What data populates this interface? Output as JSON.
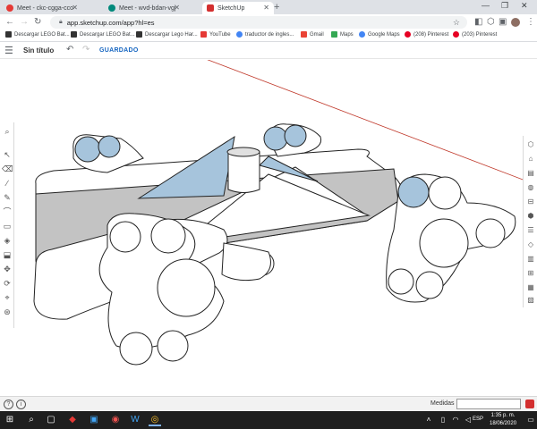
{
  "browser": {
    "tabs": [
      {
        "title": "Meet - ckc-cgga-cco",
        "favicon": "meet-record-icon"
      },
      {
        "title": "Meet - wvd-bdan-vgj",
        "favicon": "meet-icon"
      },
      {
        "title": "SketchUp",
        "favicon": "sketchup-icon",
        "active": true
      }
    ],
    "new_tab_symbol": "+",
    "url": "app.sketchup.com/app?hl=es",
    "bookmarks": [
      {
        "label": "Descargar LEGO Bat...",
        "icon": "lego-icon"
      },
      {
        "label": "Descargar LEGO Bat...",
        "icon": "lego-icon"
      },
      {
        "label": "Descargar Lego Har...",
        "icon": "lego-icon"
      },
      {
        "label": "YouTube",
        "icon": "youtube-icon"
      },
      {
        "label": "traductor de ingles...",
        "icon": "google-icon"
      },
      {
        "label": "Gmail",
        "icon": "gmail-icon"
      },
      {
        "label": "Maps",
        "icon": "maps-icon"
      },
      {
        "label": "Google Maps",
        "icon": "google-icon"
      },
      {
        "label": "(208) Pinterest",
        "icon": "pinterest-icon"
      },
      {
        "label": "(203) Pinterest",
        "icon": "pinterest-icon"
      }
    ]
  },
  "sketchup": {
    "document_title": "Sin título",
    "save_status": "GUARDADO",
    "measurements_label": "Medidas",
    "measurements_value": ""
  },
  "taskbar": {
    "language": "ESP",
    "time": "1:35 p. m.",
    "date": "18/06/2020"
  },
  "colors": {
    "accent_blue": "#1565c0",
    "model_blue": "#a6c4dc",
    "model_gray": "#c3c3c3",
    "axis_red": "#c0392b"
  }
}
